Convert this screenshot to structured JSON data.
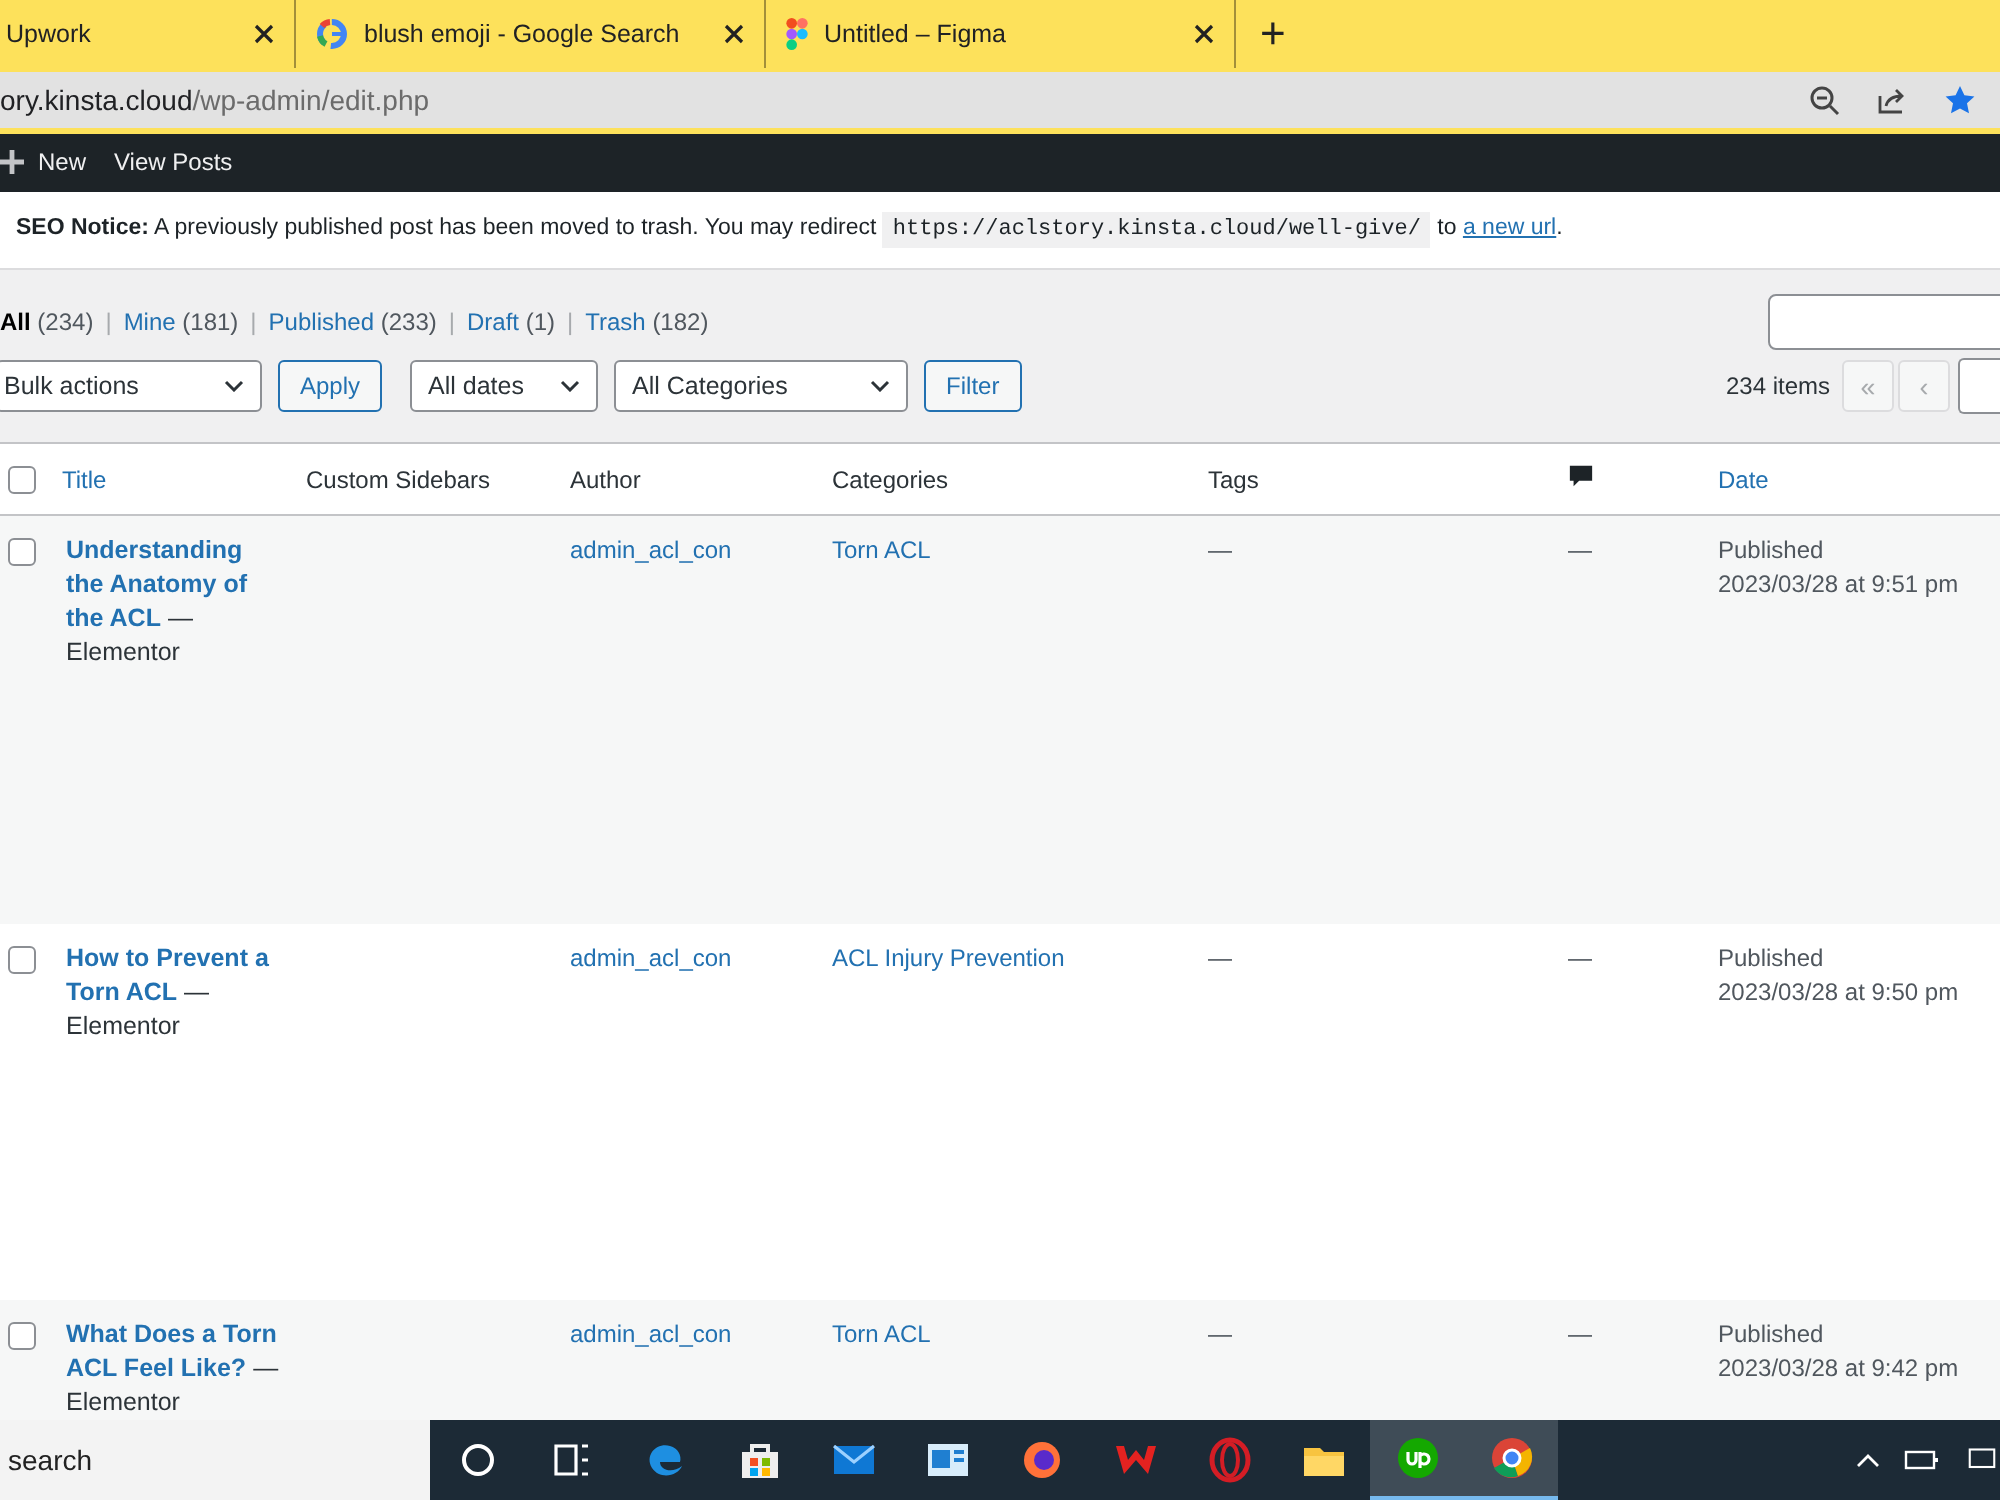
{
  "browser": {
    "tabs": [
      {
        "title": "Upwork",
        "kind": "plain",
        "selected": false
      },
      {
        "title": "blush emoji - Google Search",
        "kind": "search",
        "selected": false
      },
      {
        "title": "Untitled – Figma",
        "kind": "design",
        "selected": false
      }
    ],
    "new_tab": "+",
    "address": {
      "host": "ory.kinsta.cloud",
      "path": "/wp-admin/edit.php"
    }
  },
  "admin_bar": {
    "items": [
      {
        "label": "New",
        "kind": "new"
      },
      {
        "label": "View Posts",
        "kind": "plain"
      }
    ]
  },
  "notice": {
    "label": "SEO Notice:",
    "text": "A previously published post has been moved to trash. You may redirect",
    "code": "https://aclstory.kinsta.cloud/well-give/",
    "joiner": "to",
    "link": "a new url",
    "end": "."
  },
  "views": [
    {
      "label": "All",
      "count": "(234)",
      "selected": true
    },
    {
      "separator": "|",
      "label": "Mine",
      "count": "(181)",
      "selected": false
    },
    {
      "separator": "|",
      "label": "Published",
      "count": "(233)",
      "selected": false
    },
    {
      "separator": "|",
      "label": "Draft",
      "count": "(1)",
      "selected": false
    },
    {
      "separator": "|",
      "label": "Trash",
      "count": "(182)",
      "selected": false
    }
  ],
  "filters": {
    "bulk": "Bulk actions",
    "apply": "Apply",
    "dates": "All dates",
    "categories": "All Categories",
    "filter": "Filter"
  },
  "pagination": {
    "count": "234 items",
    "first": "«",
    "prev": "‹"
  },
  "table": {
    "all_checked": false,
    "columns": [
      {
        "label": "Title",
        "kind": "sortable"
      },
      {
        "label": "Custom Sidebars",
        "kind": "plain"
      },
      {
        "label": "Author",
        "kind": "plain"
      },
      {
        "label": "Categories",
        "kind": "plain"
      },
      {
        "label": "Tags",
        "kind": "plain"
      },
      {
        "kind": "comments"
      },
      {
        "label": "Date",
        "kind": "sortable"
      }
    ],
    "rows": [
      {
        "title": "Understanding the Anatomy of the ACL",
        "state": "— Elementor",
        "author": "admin_acl_con",
        "category": "Torn ACL",
        "tags": "—",
        "comments": "—",
        "status": "Published",
        "date": "2023/03/28 at 9:51 pm",
        "checked": false
      },
      {
        "title": "How to Prevent a Torn ACL",
        "state": "— Elementor",
        "author": "admin_acl_con",
        "category": "ACL Injury Prevention",
        "tags": "—",
        "comments": "—",
        "status": "Published",
        "date": "2023/03/28 at 9:50 pm",
        "checked": false
      },
      {
        "title": "What Does a Torn ACL Feel Like?",
        "state": "— Elementor",
        "author": "admin_acl_con",
        "category": "Torn ACL",
        "tags": "—",
        "comments": "—",
        "status": "Published",
        "date": "2023/03/28 at 9:42 pm",
        "checked": false
      }
    ]
  },
  "taskbar": {
    "search": "search",
    "apps": [
      {
        "kind": "cortana",
        "active": false
      },
      {
        "kind": "taskview",
        "active": false
      },
      {
        "kind": "edge",
        "active": false
      },
      {
        "kind": "store",
        "active": false
      },
      {
        "kind": "mail",
        "active": false
      },
      {
        "kind": "photos",
        "active": false
      },
      {
        "kind": "firefox",
        "active": false
      },
      {
        "kind": "wps",
        "active": false
      },
      {
        "kind": "opera",
        "active": false
      },
      {
        "kind": "explorer",
        "active": false
      },
      {
        "kind": "upwork",
        "active": true
      },
      {
        "kind": "chrome",
        "active": true
      }
    ]
  }
}
